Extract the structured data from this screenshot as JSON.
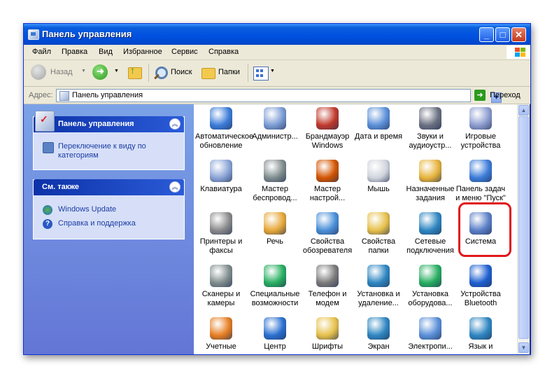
{
  "window": {
    "title": "Панель управления",
    "buttons": {
      "minimize": "_",
      "maximize": "□",
      "close": "✕"
    }
  },
  "menu": [
    "Файл",
    "Правка",
    "Вид",
    "Избранное",
    "Сервис",
    "Справка"
  ],
  "toolbar": {
    "back": "Назад",
    "search": "Поиск",
    "folders": "Папки"
  },
  "address": {
    "label": "Адрес:",
    "value": "Панель управления",
    "go": "Переход"
  },
  "left_pane": {
    "panel1": {
      "title": "Панель управления",
      "link": "Переключение к виду по категориям"
    },
    "panel2": {
      "title": "См. также",
      "links": [
        "Windows Update",
        "Справка и поддержка"
      ]
    }
  },
  "items": [
    {
      "label": "Автоматическое обновление",
      "icon": "globe-shield-icon"
    },
    {
      "label": "Администр...",
      "icon": "admin-tools-icon"
    },
    {
      "label": "Брандмауэр Windows",
      "icon": "firewall-icon"
    },
    {
      "label": "Дата и время",
      "icon": "clock-icon"
    },
    {
      "label": "Звуки и аудиоустр...",
      "icon": "speaker-icon"
    },
    {
      "label": "Игровые устройства",
      "icon": "gamepad-icon"
    },
    {
      "label": "Клавиатура",
      "icon": "keyboard-icon"
    },
    {
      "label": "Мастер беспровод...",
      "icon": "wireless-icon"
    },
    {
      "label": "Мастер настрой...",
      "icon": "network-house-icon"
    },
    {
      "label": "Мышь",
      "icon": "mouse-icon"
    },
    {
      "label": "Назначенные задания",
      "icon": "scheduled-tasks-icon"
    },
    {
      "label": "Панель задач и меню \"Пуск\"",
      "icon": "taskbar-icon"
    },
    {
      "label": "Принтеры и факсы",
      "icon": "printer-icon"
    },
    {
      "label": "Речь",
      "icon": "speech-icon"
    },
    {
      "label": "Свойства обозревателя",
      "icon": "internet-options-icon"
    },
    {
      "label": "Свойства папки",
      "icon": "folder-options-icon"
    },
    {
      "label": "Сетевые подключения",
      "icon": "network-connections-icon"
    },
    {
      "label": "Система",
      "icon": "system-icon"
    },
    {
      "label": "Сканеры и камеры",
      "icon": "scanner-icon"
    },
    {
      "label": "Специальные возможности",
      "icon": "accessibility-icon"
    },
    {
      "label": "Телефон и модем",
      "icon": "phone-icon"
    },
    {
      "label": "Установка и удаление...",
      "icon": "add-remove-icon"
    },
    {
      "label": "Установка оборудова...",
      "icon": "hardware-icon"
    },
    {
      "label": "Устройства Bluetooth",
      "icon": "bluetooth-icon"
    },
    {
      "label": "Учетные",
      "icon": "user-accounts-icon"
    },
    {
      "label": "Центр",
      "icon": "security-center-icon"
    },
    {
      "label": "Шрифты",
      "icon": "fonts-icon"
    },
    {
      "label": "Экран",
      "icon": "display-icon"
    },
    {
      "label": "Электропи...",
      "icon": "power-icon"
    },
    {
      "label": "Язык и",
      "icon": "language-icon"
    }
  ],
  "highlighted_item": "Система"
}
